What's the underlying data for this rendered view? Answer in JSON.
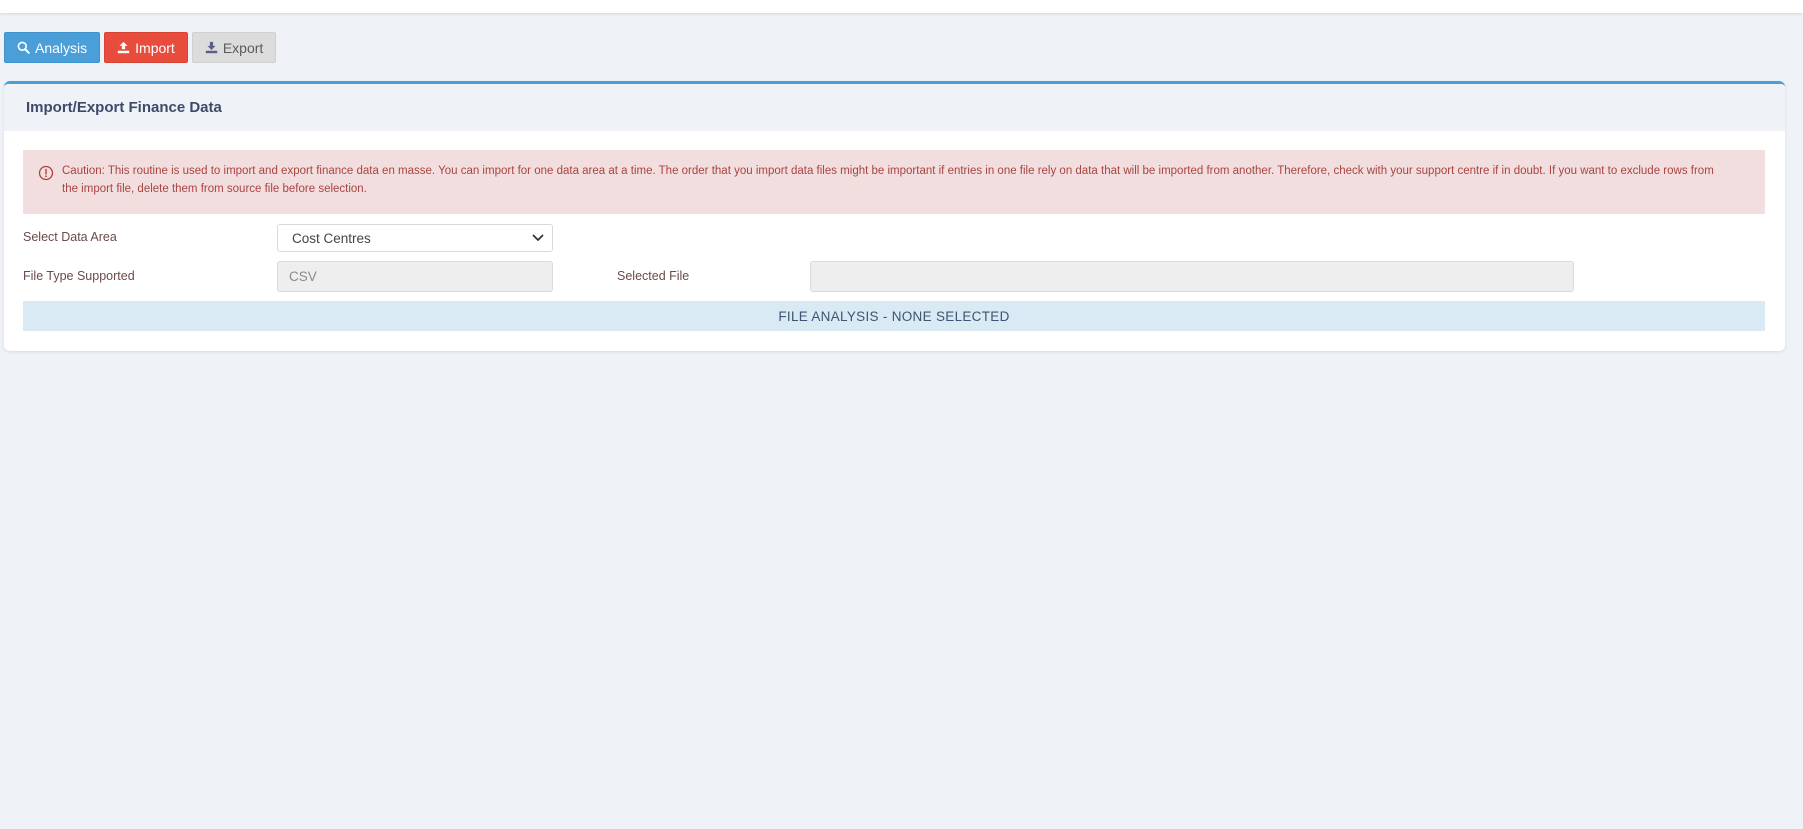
{
  "toolbar": {
    "analysis_label": "Analysis",
    "import_label": "Import",
    "export_label": "Export"
  },
  "panel": {
    "title": "Import/Export Finance Data",
    "caution_text": "Caution: This routine is used to import and export finance data en masse. You can import for one data area at a time. The order that you import data files might be important if entries in one file rely on data that will be imported from another. Therefore, check with your support centre if in doubt. If you want to exclude rows from the import file, delete them from source file before selection.",
    "select_data_area_label": "Select Data Area",
    "select_data_area_value": "Cost Centres",
    "file_type_label": "File Type Supported",
    "file_type_value": "CSV",
    "selected_file_label": "Selected File",
    "selected_file_value": "",
    "file_analysis_text": "FILE ANALYSIS - NONE SELECTED"
  },
  "colors": {
    "analysis_button": "#4a9fd9",
    "import_button": "#e74c3c",
    "export_button": "#dcdcdc",
    "caution_background": "#f2dede",
    "caution_text": "#a94442",
    "analysis_bar": "#d9eaf5"
  },
  "icons": {
    "analysis": "search-icon",
    "import": "upload-icon",
    "export": "download-icon",
    "caution": "info-circle-icon",
    "select": "chevron-down-icon"
  }
}
